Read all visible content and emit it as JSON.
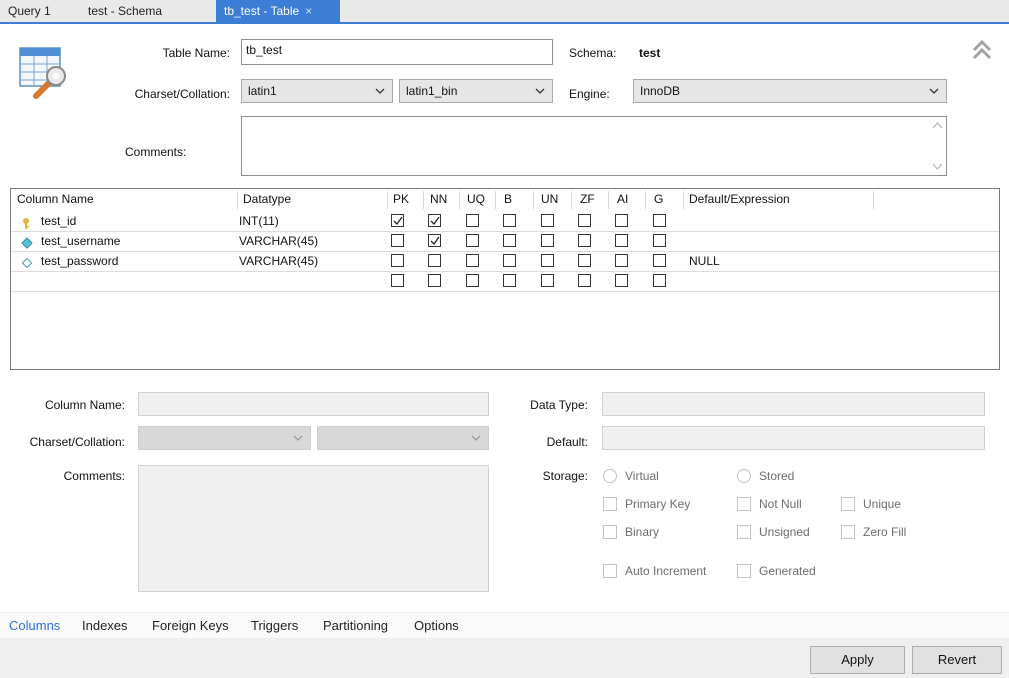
{
  "doc_tabs": {
    "items": [
      "Query 1",
      "test - Schema",
      "tb_test - Table"
    ],
    "close_glyph": "×",
    "active_color": "#3c7ed6"
  },
  "header": {
    "icon": "table-wrench-icon",
    "table_name_label": "Table Name:",
    "table_name": "tb_test",
    "schema_label": "Schema:",
    "schema": "test",
    "charset_label": "Charset/Collation:",
    "charset": "latin1",
    "collation": "latin1_bin",
    "engine_label": "Engine:",
    "engine": "InnoDB",
    "comments_label": "Comments:",
    "comments": ""
  },
  "columns_grid": {
    "headers": [
      "Column Name",
      "Datatype",
      "PK",
      "NN",
      "UQ",
      "B",
      "UN",
      "ZF",
      "AI",
      "G",
      "Default/Expression"
    ],
    "rows": [
      {
        "icon": "key-icon",
        "name": "test_id",
        "datatype": "INT(11)",
        "flags": [
          true,
          true,
          false,
          false,
          false,
          false,
          false,
          false
        ],
        "default": ""
      },
      {
        "icon": "diamond-filled-icon",
        "name": "test_username",
        "datatype": "VARCHAR(45)",
        "flags": [
          false,
          true,
          false,
          false,
          false,
          false,
          false,
          false
        ],
        "default": ""
      },
      {
        "icon": "diamond-outline-icon",
        "name": "test_password",
        "datatype": "VARCHAR(45)",
        "flags": [
          false,
          false,
          false,
          false,
          false,
          false,
          false,
          false
        ],
        "default": "NULL"
      },
      {
        "icon": "",
        "name": "",
        "datatype": "",
        "flags": [
          false,
          false,
          false,
          false,
          false,
          false,
          false,
          false
        ],
        "default": ""
      }
    ]
  },
  "details": {
    "column_name_label": "Column Name:",
    "charset_label": "Charset/Collation:",
    "comments_label": "Comments:",
    "data_type_label": "Data Type:",
    "default_label": "Default:",
    "storage_label": "Storage:",
    "virtual": "Virtual",
    "stored": "Stored",
    "primary_key": "Primary Key",
    "not_null": "Not Null",
    "unique": "Unique",
    "binary": "Binary",
    "unsigned": "Unsigned",
    "zero_fill": "Zero Fill",
    "auto_increment": "Auto Increment",
    "generated": "Generated"
  },
  "sub_tabs": [
    "Columns",
    "Indexes",
    "Foreign Keys",
    "Triggers",
    "Partitioning",
    "Options"
  ],
  "buttons": {
    "apply": "Apply",
    "revert": "Revert"
  }
}
